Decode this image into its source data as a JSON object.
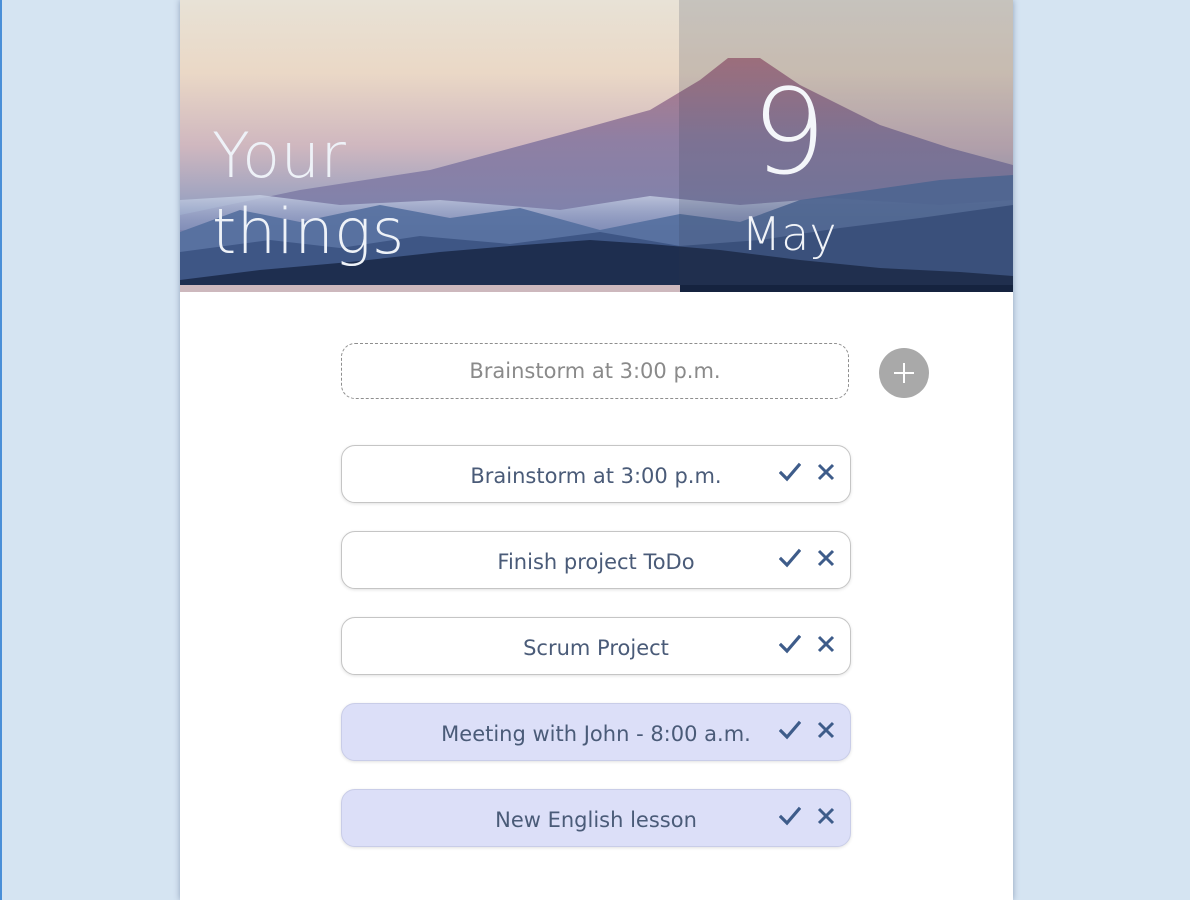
{
  "header": {
    "title_line1": "Your",
    "title_line2": "things",
    "day": "9",
    "month": "May",
    "progress_fraction": 0.6
  },
  "new_task": {
    "placeholder": "Brainstorm at 3:00 p.m.",
    "add_icon": "plus-icon"
  },
  "tasks": [
    {
      "label": "Brainstorm at 3:00 p.m.",
      "highlighted": false
    },
    {
      "label": "Finish project ToDo",
      "highlighted": false
    },
    {
      "label": "Scrum Project",
      "highlighted": false
    },
    {
      "label": "Meeting with John - 8:00 a.m.",
      "highlighted": true
    },
    {
      "label": "New English lesson",
      "highlighted": true
    }
  ],
  "icons": {
    "complete": "checkmark-icon",
    "delete": "close-icon"
  },
  "colors": {
    "accent": "#3e5c8a",
    "highlight_row": "#dcdff8",
    "add_button": "#a9a9a9",
    "page_background": "#d5e4f2"
  }
}
